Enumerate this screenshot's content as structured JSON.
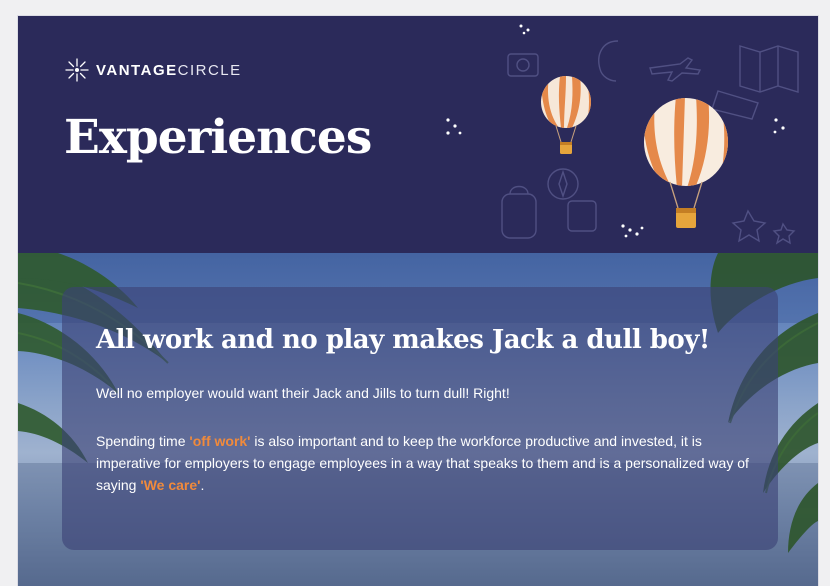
{
  "brand": {
    "name_bold": "VANTAGE",
    "name_light": "CIRCLE"
  },
  "header": {
    "title": "Experiences"
  },
  "panel": {
    "heading": "All work and no play makes Jack a dull boy!",
    "paragraph1": "Well no employer would want their Jack and Jills to turn dull! Right!",
    "paragraph2": {
      "part1": "Spending time ",
      "highlight1": "'off work'",
      "part2": " is also important and to keep the workforce productive and invested,  it is imperative for employers to engage employees in a way that speaks to them and is a personalized way of saying ",
      "highlight2": "'We care'",
      "part3": "."
    }
  },
  "colors": {
    "header_bg": "#2b2a5a",
    "accent_orange": "#f08a3c",
    "balloon_stripe": "#e5894a",
    "panel_bg": "rgba(60,66,118,0.62)"
  },
  "icons": [
    "vantage-circle-logo-icon",
    "hot-air-balloon-small-icon",
    "hot-air-balloon-large-icon",
    "travel-doodles",
    "palm-leaves"
  ]
}
